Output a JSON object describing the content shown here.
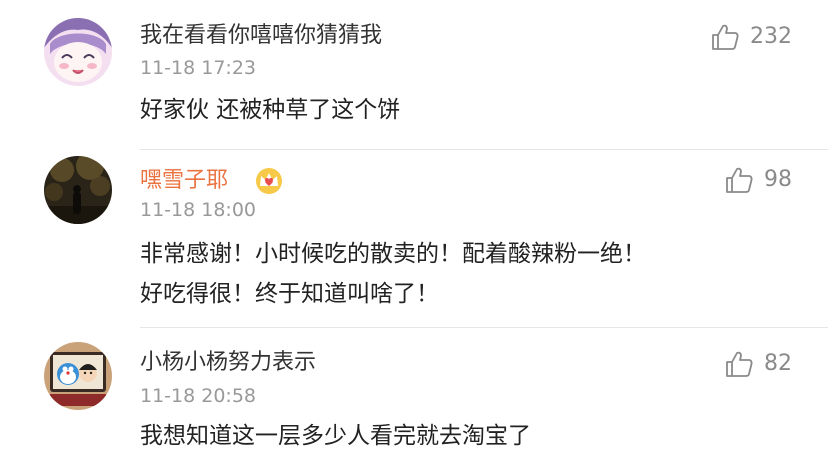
{
  "comments": [
    {
      "username": "我在看看你嘻嘻你猜猜我",
      "username_color": "#333333",
      "vip": false,
      "avatar": "anime-girl-avatar",
      "time": "11-18 17:23",
      "text_lines": [
        "好家伙 还被种草了这个饼"
      ],
      "likes": "232",
      "like_icon": "thumb-up-icon"
    },
    {
      "username": "嘿雪子耶",
      "username_color": "#eb7340",
      "vip": true,
      "vip_icon": "vip-crown-icon",
      "avatar": "night-scene-avatar",
      "time": "11-18 18:00",
      "text_lines": [
        "非常感谢！小时候吃的散卖的！配着酸辣粉一绝！",
        "好吃得很！终于知道叫啥了！"
      ],
      "likes": "98",
      "like_icon": "thumb-up-icon"
    },
    {
      "username": "小杨小杨努力表示",
      "username_color": "#333333",
      "vip": false,
      "avatar": "doraemon-avatar",
      "time": "11-18 20:58",
      "text_lines": [
        "我想知道这一层多少人看完就去淘宝了"
      ],
      "likes": "82",
      "like_icon": "thumb-up-icon"
    }
  ],
  "colors": {
    "vip_name": "#eb7340",
    "time": "#999999",
    "like_count": "#8a8a8a",
    "divider": "#e6e6e6"
  }
}
